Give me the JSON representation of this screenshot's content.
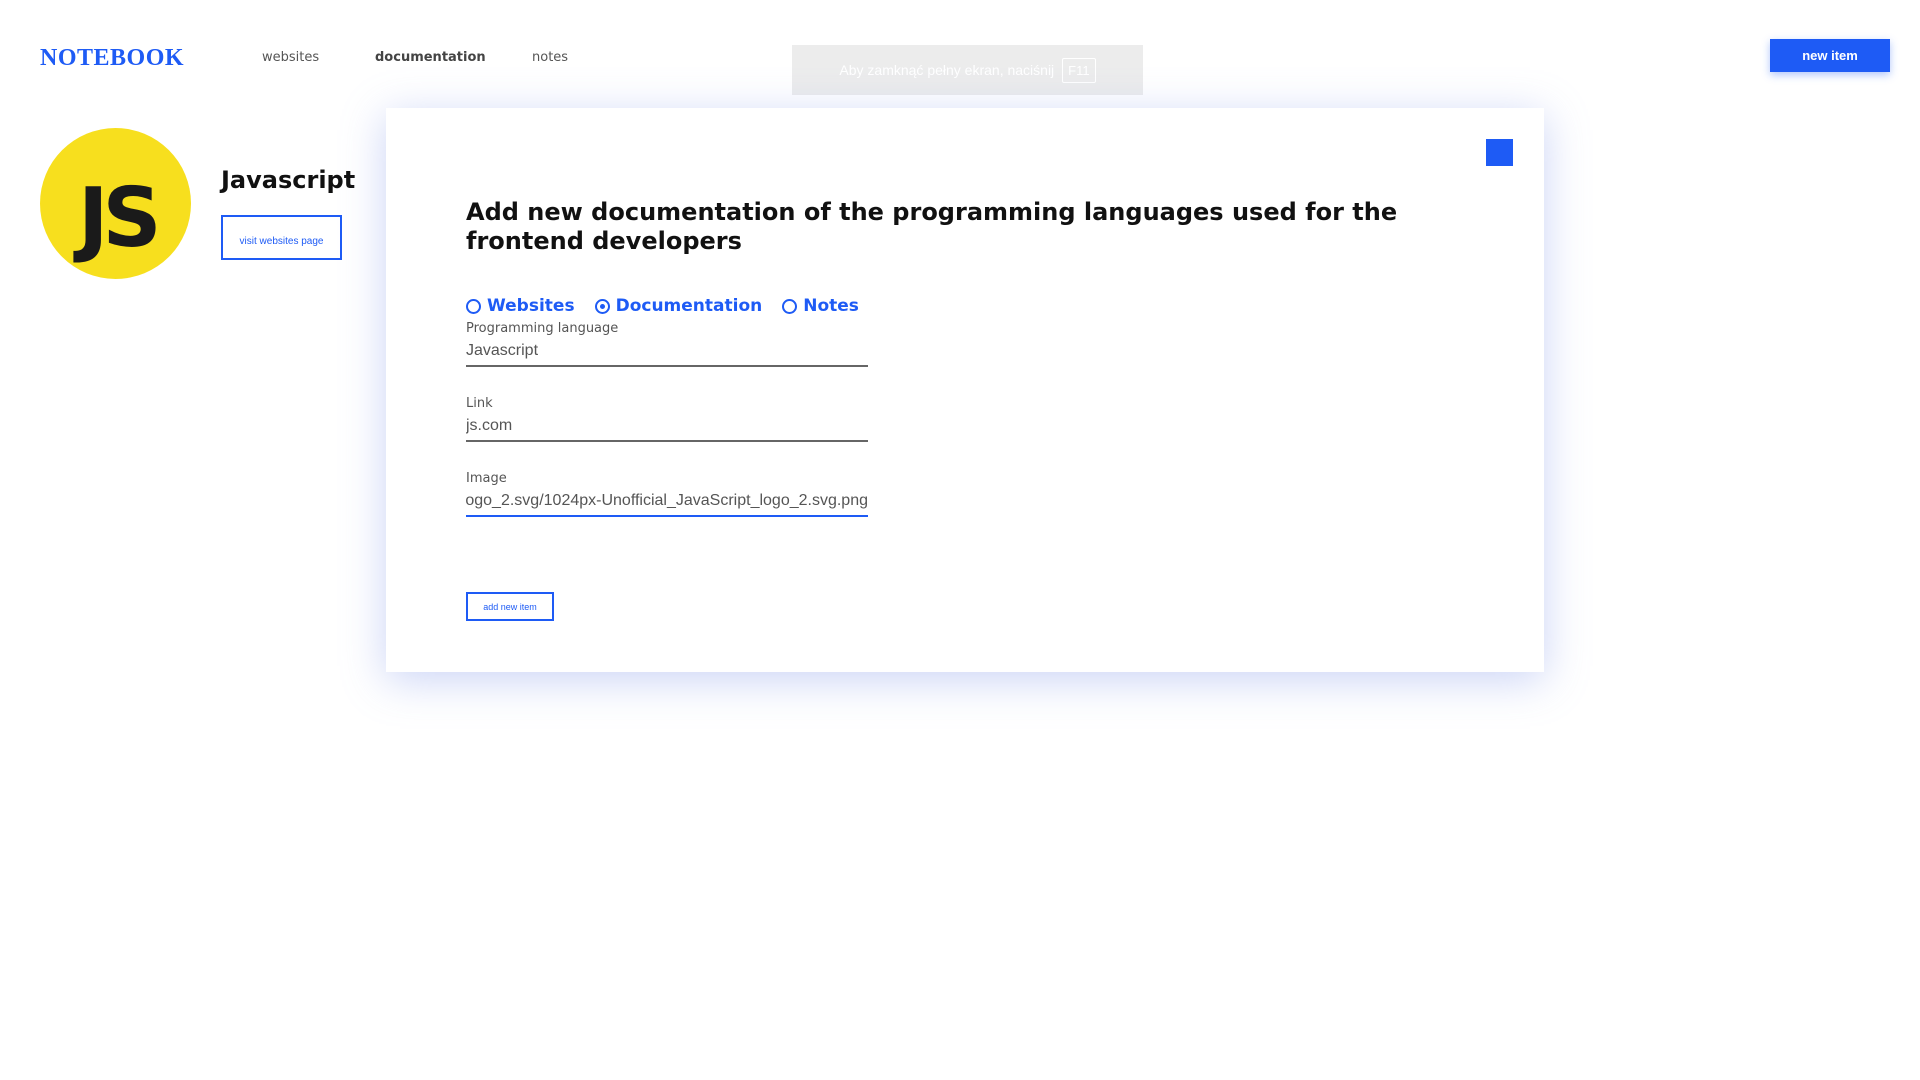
{
  "header": {
    "logo": "NOTEBOOK",
    "nav": [
      {
        "label": "websites",
        "active": false
      },
      {
        "label": "documentation",
        "active": true
      },
      {
        "label": "notes",
        "active": false
      }
    ],
    "new_item_label": "new item",
    "fullscreen_notice": {
      "text": "Aby zamknąć pełny ekran, naciśnij",
      "key": "F11"
    }
  },
  "profile": {
    "logo_text": "JS",
    "title": "Javascript",
    "visit_label": "visit websites page"
  },
  "modal": {
    "title": "Add new documentation of the programming languages used for the frontend developers",
    "radios": [
      {
        "label": "Websites",
        "checked": false
      },
      {
        "label": "Documentation",
        "checked": true
      },
      {
        "label": "Notes",
        "checked": false
      }
    ],
    "fields": {
      "language": {
        "label": "Programming language",
        "value": "Javascript"
      },
      "link": {
        "label": "Link",
        "value": "js.com"
      },
      "image": {
        "label": "Image",
        "value": "ogo_2.svg/1024px-Unofficial_JavaScript_logo_2.svg.png"
      }
    },
    "add_label": "add new item"
  },
  "colors": {
    "accent": "#1e5bf5",
    "js_yellow": "#f7df1e"
  },
  "icons": {
    "close": "close-icon"
  }
}
